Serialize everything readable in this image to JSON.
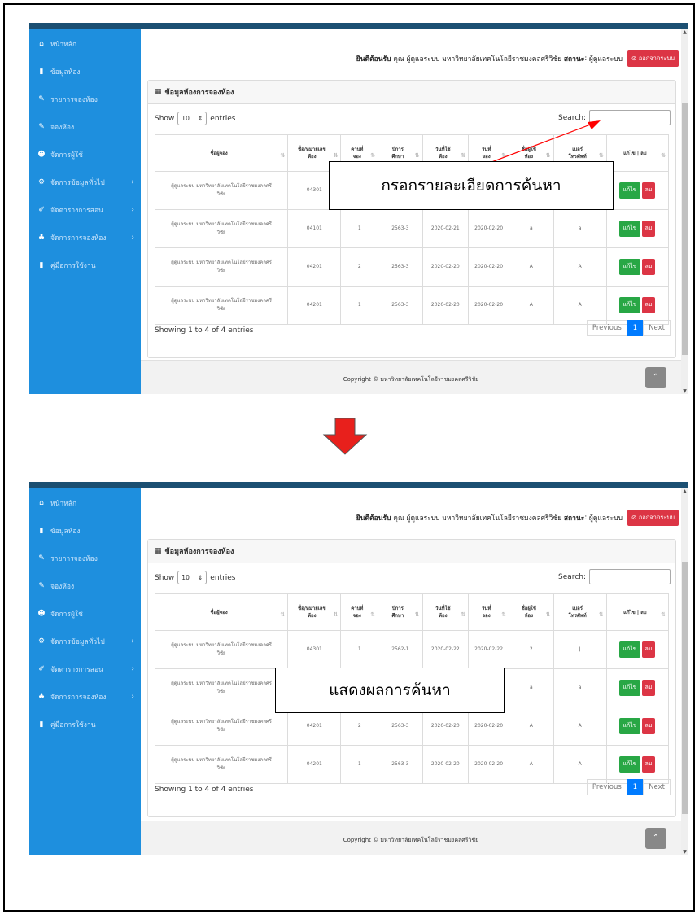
{
  "sidebar": {
    "items": [
      {
        "label": "หน้าหลัก",
        "icon": "home-icon",
        "glyph": "⌂",
        "submenu": false
      },
      {
        "label": "ข้อมูลห้อง",
        "icon": "book-icon",
        "glyph": "▮",
        "submenu": false
      },
      {
        "label": "รายการจองห้อง",
        "icon": "pencil-icon",
        "glyph": "✎",
        "submenu": false
      },
      {
        "label": "จองห้อง",
        "icon": "pencil-icon",
        "glyph": "✎",
        "submenu": false
      },
      {
        "label": "จัดการผู้ใช้",
        "icon": "user-icon",
        "glyph": "☻",
        "submenu": false
      },
      {
        "label": "จัดการข้อมูลทั่วไป",
        "icon": "cogs-icon",
        "glyph": "⚙",
        "submenu": true
      },
      {
        "label": "จัดตารางการสอน",
        "icon": "edit-icon",
        "glyph": "✐",
        "submenu": true
      },
      {
        "label": "จัดการการจองห้อง",
        "icon": "sitemap-icon",
        "glyph": "♣",
        "submenu": true
      },
      {
        "label": "คู่มือการใช้งาน",
        "icon": "book-icon",
        "glyph": "▮",
        "submenu": false
      }
    ]
  },
  "header": {
    "welcome_label": "ยินดีต้อนรับ",
    "user_text": "คุณ ผู้ดูแลระบบ มหาวิทยาลัยเทคโนโลยีราชมงคลศรีวิชัย",
    "status_label": "สถานะ",
    "status_value": "ผู้ดูแลระบบ",
    "logout_label": "ออกจากระบบ"
  },
  "panel": {
    "title": "ข้อมูลห้องการจองห้อง",
    "show_label": "Show",
    "entries_value": "10",
    "entries_label": "entries",
    "search_label": "Search:",
    "columns": [
      {
        "line1": "ชื่อผู้จอง",
        "line2": ""
      },
      {
        "line1": "ชื่อ/หมายเลข",
        "line2": "ห้อง"
      },
      {
        "line1": "คาบที่",
        "line2": "จอง"
      },
      {
        "line1": "ปีการ",
        "line2": "ศึกษา"
      },
      {
        "line1": "วันที่ใช้",
        "line2": "ห้อง"
      },
      {
        "line1": "วันที่",
        "line2": "จอง"
      },
      {
        "line1": "ชื่อผู้ใช้",
        "line2": "ห้อง"
      },
      {
        "line1": "เบอร์",
        "line2": "โทรศัพท์"
      },
      {
        "line1": "แก้ไข | ลบ",
        "line2": ""
      }
    ],
    "rows": [
      {
        "name1": "ผู้ดูแลระบบ มหาวิทยาลัยเทคโนโลยีราชมงคลศรี",
        "name2": "วิชัย",
        "room": "04301",
        "period": "1",
        "year": "2562-1",
        "use_date": "2020-02-22",
        "book_date": "2020-02-22",
        "user": "2",
        "phone": "J"
      },
      {
        "name1": "ผู้ดูแลระบบ มหาวิทยาลัยเทคโนโลยีราชมงคลศรี",
        "name2": "วิชัย",
        "room": "04101",
        "period": "1",
        "year": "2563-3",
        "use_date": "2020-02-21",
        "book_date": "2020-02-20",
        "user": "a",
        "phone": "a"
      },
      {
        "name1": "ผู้ดูแลระบบ มหาวิทยาลัยเทคโนโลยีราชมงคลศรี",
        "name2": "วิชัย",
        "room": "04201",
        "period": "2",
        "year": "2563-3",
        "use_date": "2020-02-20",
        "book_date": "2020-02-20",
        "user": "A",
        "phone": "A"
      },
      {
        "name1": "ผู้ดูแลระบบ มหาวิทยาลัยเทคโนโลยีราชมงคลศรี",
        "name2": "วิชัย",
        "room": "04201",
        "period": "1",
        "year": "2563-3",
        "use_date": "2020-02-20",
        "book_date": "2020-02-20",
        "user": "A",
        "phone": "A"
      }
    ],
    "edit_label": "แก้ไข",
    "delete_label": "ลบ",
    "info_text": "Showing 1 to 4 of 4 entries",
    "previous_label": "Previous",
    "current_page": "1",
    "next_label": "Next"
  },
  "footer": {
    "copyright": "Copyright © มหาวิทยาลัยเทคโนโลยีราชมงคลศรีวิชัย"
  },
  "annotations": {
    "step1_caption": "กรอกรายละเอียดการค้นหา",
    "step2_caption": "แสดงผลการค้นหา"
  },
  "colors": {
    "sidebar": "#1e8fde",
    "topbar": "#1b4f72",
    "edit_button": "#28a745",
    "delete_button": "#dc3545",
    "pager_active": "#007bff",
    "arrow": "#e8201c",
    "annotation_line": "#ff0000"
  }
}
